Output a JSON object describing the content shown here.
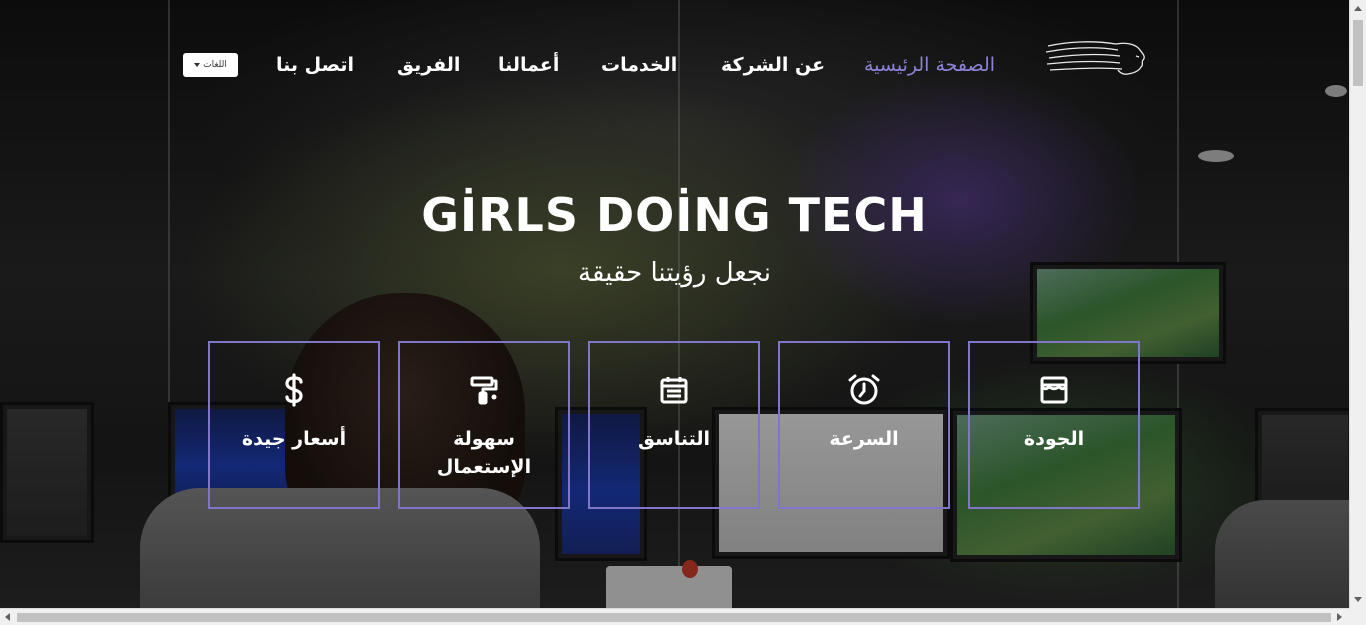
{
  "navbar": {
    "logo_icon": "girl-profile-logo",
    "items": [
      {
        "label": "الصفحة الرئيسية",
        "active": true
      },
      {
        "label": "عن الشركة",
        "active": false
      },
      {
        "label": "الخدمات",
        "active": false
      },
      {
        "label": "أعمالنا",
        "active": false
      },
      {
        "label": "الفريق",
        "active": false
      },
      {
        "label": "اتصل بنا",
        "active": false
      }
    ],
    "language_button": "اللغات",
    "active_color": "#8d83d6"
  },
  "hero": {
    "title": "GİRLS DOİNG TECH",
    "subtitle": "نجعل رؤيتنا حقيقة"
  },
  "features": [
    {
      "label": "أسعار جيدة",
      "icon": "dollar-icon"
    },
    {
      "label": "سهولة الإستعمال",
      "icon": "paint-roller-icon"
    },
    {
      "label": "التناسق",
      "icon": "calendar-icon"
    },
    {
      "label": "السرعة",
      "icon": "alarm-clock-icon"
    },
    {
      "label": "الجودة",
      "icon": "store-icon"
    }
  ],
  "accent_color": "#7f76c9"
}
